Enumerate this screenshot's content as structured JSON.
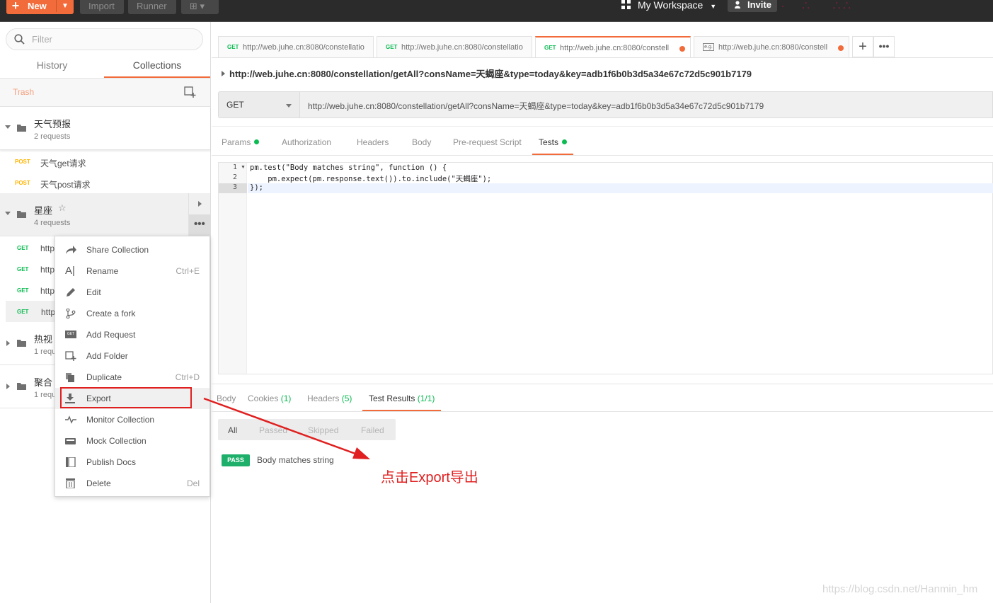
{
  "topbar": {
    "new_label": "New",
    "import_label": "Import",
    "runner_label": "Runner",
    "workspace_label": "My Workspace",
    "invite_label": "Invite"
  },
  "sidebar": {
    "filter_placeholder": "Filter",
    "tabs": {
      "history": "History",
      "collections": "Collections"
    },
    "trash_label": "Trash",
    "collections": [
      {
        "name": "天气预报",
        "count": "2 requests"
      },
      {
        "name": "星座",
        "count": "4 requests"
      },
      {
        "name": "热视",
        "count": "1 requ"
      },
      {
        "name": "聚合",
        "count": "1 requ"
      }
    ],
    "requests_weather": [
      {
        "method": "POST",
        "name": "天气get请求"
      },
      {
        "method": "POST",
        "name": "天气post请求"
      }
    ],
    "requests_star": [
      {
        "method": "GET",
        "name": "http"
      },
      {
        "method": "GET",
        "name": "http"
      },
      {
        "method": "GET",
        "name": "http"
      },
      {
        "method": "GET",
        "name": "http"
      }
    ]
  },
  "menu": {
    "share": "Share Collection",
    "rename": "Rename",
    "rename_shortcut": "Ctrl+E",
    "edit": "Edit",
    "fork": "Create a fork",
    "add_request": "Add Request",
    "add_folder": "Add Folder",
    "duplicate": "Duplicate",
    "duplicate_shortcut": "Ctrl+D",
    "export": "Export",
    "monitor": "Monitor Collection",
    "mock": "Mock Collection",
    "publish": "Publish Docs",
    "delete": "Delete",
    "delete_shortcut": "Del"
  },
  "tabs": [
    {
      "method": "GET",
      "url": "http://web.juhe.cn:8080/constellatio"
    },
    {
      "method": "GET",
      "url": "http://web.juhe.cn:8080/constellatio"
    },
    {
      "method": "GET",
      "url": "http://web.juhe.cn:8080/constell"
    },
    {
      "method": "e.g.",
      "url": "http://web.juhe.cn:8080/constell"
    }
  ],
  "request": {
    "title_url": "http://web.juhe.cn:8080/constellation/getAll?consName=天蝎座&type=today&key=adb1f6b0b3d5a34e67c72d5c901b7179",
    "method": "GET",
    "url": "http://web.juhe.cn:8080/constellation/getAll?consName=天蝎座&type=today&key=adb1f6b0b3d5a34e67c72d5c901b7179"
  },
  "subtabs": {
    "params": "Params",
    "authorization": "Authorization",
    "headers": "Headers",
    "body": "Body",
    "prerequest": "Pre-request Script",
    "tests": "Tests"
  },
  "editor": {
    "lines": [
      {
        "no": "1",
        "text": "pm.test(\"Body matches string\", function () {"
      },
      {
        "no": "2",
        "text": "    pm.expect(pm.response.text()).to.include(\"天蝎座\");"
      },
      {
        "no": "3",
        "text": "});"
      }
    ]
  },
  "response": {
    "body": "Body",
    "cookies": "Cookies",
    "cookies_count": "(1)",
    "headers": "Headers",
    "headers_count": "(5)",
    "test_results": "Test Results",
    "test_results_count": "(1/1)",
    "filters": {
      "all": "All",
      "passed": "Passed",
      "skipped": "Skipped",
      "failed": "Failed"
    },
    "result_status": "PASS",
    "result_name": "Body matches string"
  },
  "annotation": "点击Export导出",
  "watermark": "https://blog.csdn.net/Hanmin_hm",
  "colors": {
    "accent": "#f26b3a",
    "get": "#0cbb52",
    "post": "#ffb400",
    "annotation": "#e02020"
  }
}
